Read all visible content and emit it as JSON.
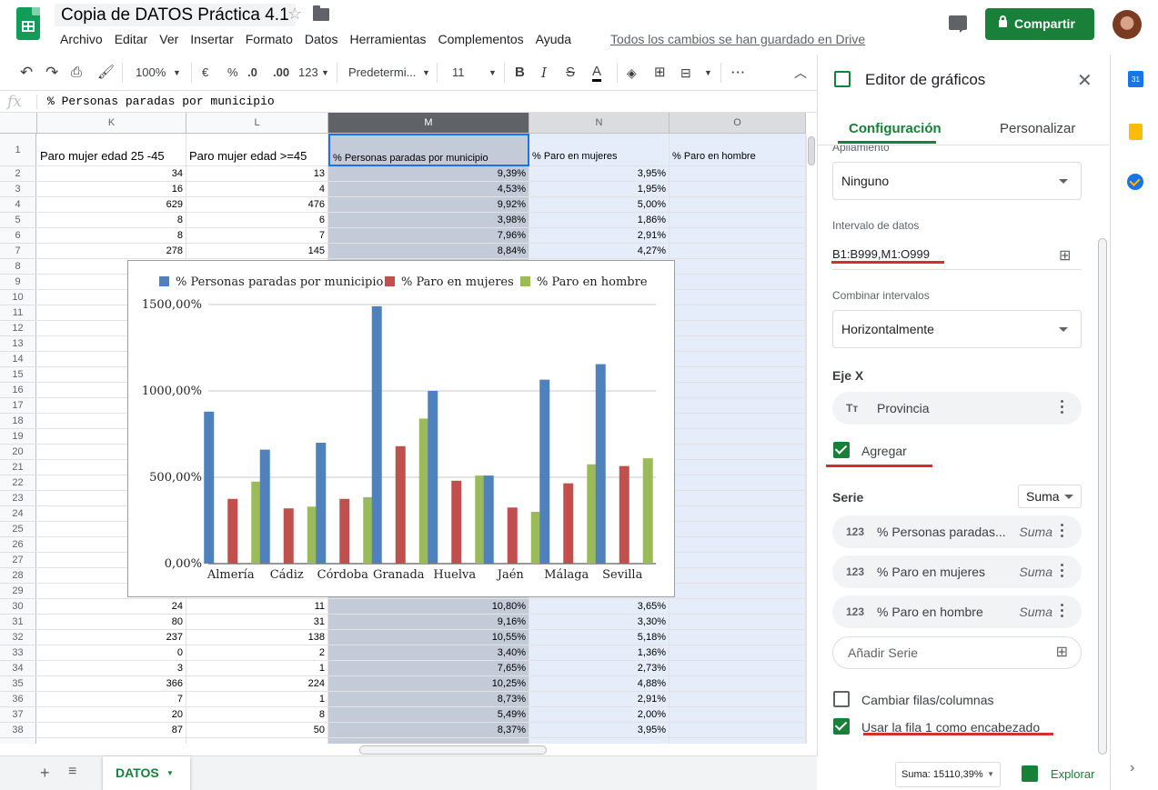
{
  "doc": {
    "title": "Copia de DATOS Práctica 4.1",
    "menus": [
      "Archivo",
      "Editar",
      "Ver",
      "Insertar",
      "Formato",
      "Datos",
      "Herramientas",
      "Complementos",
      "Ayuda"
    ],
    "saved_status": "Todos los cambios se han guardado en Drive",
    "share_label": "Compartir"
  },
  "toolbar": {
    "zoom": "100%",
    "currency": "€",
    "percent": "%",
    "dec_less": ".0",
    "dec_more": ".00",
    "more_formats": "123",
    "font": "Predetermi...",
    "font_size": "11",
    "bold": "B",
    "italic": "I",
    "strike": "S",
    "text_color": "A"
  },
  "formula_bar": {
    "fx": "fx",
    "content": "% Personas paradas por municipio"
  },
  "grid": {
    "columns": [
      "K",
      "L",
      "M",
      "N",
      "O"
    ],
    "header_row": [
      "Paro mujer edad 25 -45",
      "Paro mujer edad >=45",
      "% Personas paradas por municipio",
      "% Paro en mujeres",
      "% Paro en hombre"
    ],
    "rows_top": [
      {
        "n": "2",
        "k": "34",
        "l": "13",
        "m": "9,39%",
        "nn": "3,95%"
      },
      {
        "n": "3",
        "k": "16",
        "l": "4",
        "m": "4,53%",
        "nn": "1,95%"
      },
      {
        "n": "4",
        "k": "629",
        "l": "476",
        "m": "9,92%",
        "nn": "5,00%"
      },
      {
        "n": "5",
        "k": "8",
        "l": "6",
        "m": "3,98%",
        "nn": "1,86%"
      },
      {
        "n": "6",
        "k": "8",
        "l": "7",
        "m": "7,96%",
        "nn": "2,91%"
      },
      {
        "n": "7",
        "k": "278",
        "l": "145",
        "m": "8,84%",
        "nn": "4,27%"
      }
    ],
    "hidden_row_numbers": [
      "8",
      "9",
      "10",
      "11",
      "12",
      "13",
      "14",
      "15",
      "16",
      "17",
      "18",
      "19",
      "20",
      "21",
      "22",
      "23",
      "24",
      "25",
      "26",
      "27",
      "28",
      "29"
    ],
    "rows_bottom": [
      {
        "n": "30",
        "k": "24",
        "l": "11",
        "m": "10,80%",
        "nn": "3,65%"
      },
      {
        "n": "31",
        "k": "80",
        "l": "31",
        "m": "9,16%",
        "nn": "3,30%"
      },
      {
        "n": "32",
        "k": "237",
        "l": "138",
        "m": "10,55%",
        "nn": "5,18%"
      },
      {
        "n": "33",
        "k": "0",
        "l": "2",
        "m": "3,40%",
        "nn": "1,36%"
      },
      {
        "n": "34",
        "k": "3",
        "l": "1",
        "m": "7,65%",
        "nn": "2,73%"
      },
      {
        "n": "35",
        "k": "366",
        "l": "224",
        "m": "10,25%",
        "nn": "4,88%"
      },
      {
        "n": "36",
        "k": "7",
        "l": "1",
        "m": "8,73%",
        "nn": "2,91%"
      },
      {
        "n": "37",
        "k": "20",
        "l": "8",
        "m": "5,49%",
        "nn": "2,00%"
      },
      {
        "n": "38",
        "k": "87",
        "l": "50",
        "m": "8,37%",
        "nn": "3,95%"
      }
    ]
  },
  "chart_data": {
    "type": "bar",
    "categories": [
      "Almería",
      "Cádiz",
      "Córdoba",
      "Granada",
      "Huelva",
      "Jaén",
      "Málaga",
      "Sevilla"
    ],
    "series": [
      {
        "name": "% Personas paradas por municipio",
        "color": "#4f81bd",
        "values": [
          880,
          660,
          700,
          1490,
          1000,
          510,
          1065,
          1155
        ]
      },
      {
        "name": "% Paro en mujeres",
        "color": "#c0504d",
        "values": [
          375,
          320,
          375,
          680,
          480,
          325,
          465,
          565
        ]
      },
      {
        "name": "% Paro en hombre",
        "color": "#9bbb59",
        "values": [
          475,
          330,
          385,
          840,
          510,
          300,
          575,
          610
        ]
      }
    ],
    "ylim": [
      0,
      1500
    ],
    "yticks": [
      "0,00%",
      "500,00%",
      "1000,00%",
      "1500,00%"
    ],
    "ytick_values": [
      0,
      500,
      1000,
      1500
    ],
    "legend_position": "top",
    "grid": true
  },
  "bottom": {
    "sheet_name": "DATOS",
    "sum_label": "Suma: 15110,39%",
    "explore_label": "Explorar"
  },
  "panel": {
    "title": "Editor de gráficos",
    "tab_config": "Configuración",
    "tab_custom": "Personalizar",
    "stacking_label": "Apilamiento",
    "stacking_value": "Ninguno",
    "range_label": "Intervalo de datos",
    "range_value": "B1:B999,M1:O999",
    "combine_label": "Combinar intervalos",
    "combine_value": "Horizontalmente",
    "x_axis_heading": "Eje X",
    "x_axis_field": "Provincia",
    "x_axis_field_icon": "Tт",
    "aggregate_label": "Agregar",
    "series_heading": "Serie",
    "series_agg": "Suma",
    "series": [
      {
        "icon": "123",
        "name": "% Personas paradas...",
        "agg": "Suma"
      },
      {
        "icon": "123",
        "name": "% Paro en mujeres",
        "agg": "Suma"
      },
      {
        "icon": "123",
        "name": "% Paro en hombre",
        "agg": "Suma"
      }
    ],
    "add_series_placeholder": "Añadir Serie",
    "switch_rows_cols": "Cambiar filas/columnas",
    "use_row1_header": "Usar la fila 1 como encabezado"
  },
  "sidebar": {
    "calendar_day": "31"
  }
}
